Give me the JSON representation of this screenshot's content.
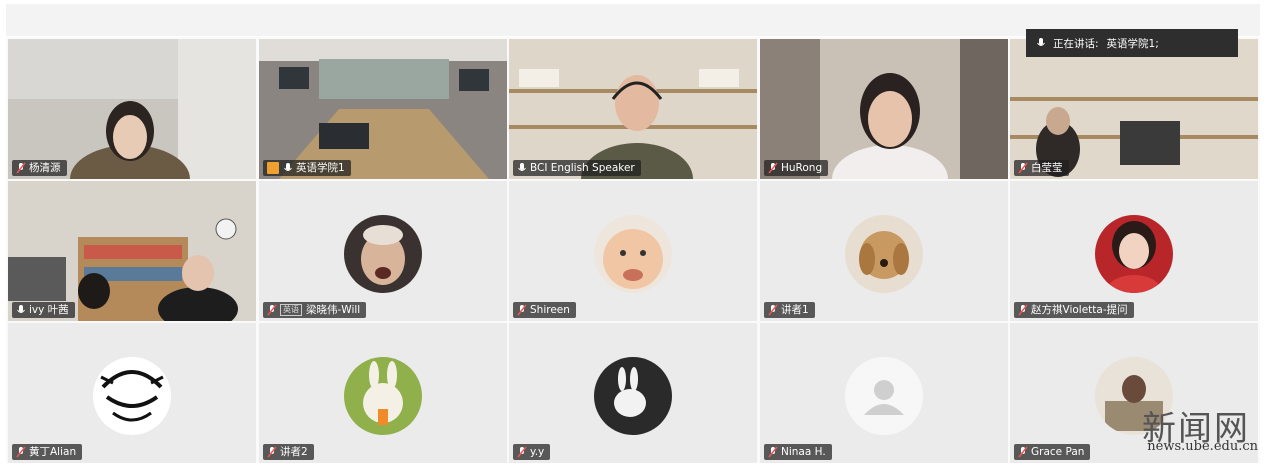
{
  "speaker_indicator": {
    "prefix": "正在讲话:",
    "name": "英语学院1;"
  },
  "tiles": [
    {
      "label": "杨清源",
      "mic": "muted"
    },
    {
      "label": "英语学院1",
      "mic": "on",
      "host": true
    },
    {
      "label": "BCI English Speaker",
      "mic": "on"
    },
    {
      "label": "HuRong",
      "mic": "muted"
    },
    {
      "label": "白莹莹",
      "mic": "muted"
    },
    {
      "label": "ivy 叶茜",
      "mic": "on"
    },
    {
      "label": "梁晓伟-Will",
      "mic": "muted",
      "tag": "英语"
    },
    {
      "label": "Shireen",
      "mic": "muted"
    },
    {
      "label": "讲者1",
      "mic": "muted"
    },
    {
      "label": "赵方祺Violetta-提问",
      "mic": "muted"
    },
    {
      "label": "黄丁Alian",
      "mic": "muted"
    },
    {
      "label": "讲者2",
      "mic": "muted"
    },
    {
      "label": "y.y",
      "mic": "muted"
    },
    {
      "label": "Ninaa H.",
      "mic": "muted"
    },
    {
      "label": "Grace Pan",
      "mic": "muted"
    }
  ],
  "watermark": {
    "title": "新闻网",
    "url": "news.ube.edu.cn"
  }
}
